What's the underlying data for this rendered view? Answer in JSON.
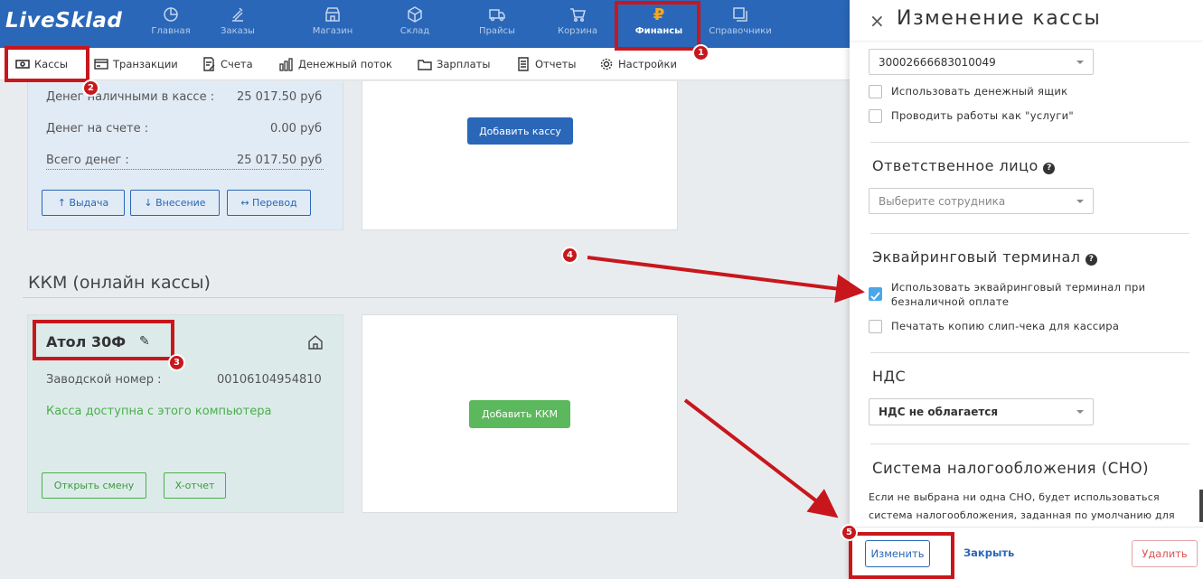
{
  "brand": "LiveSklad",
  "nav": [
    {
      "label": "Главная",
      "icon": "pie-chart-icon"
    },
    {
      "label": "Заказы",
      "icon": "clipboard-icon"
    },
    {
      "label": "Магазин",
      "icon": "store-icon"
    },
    {
      "label": "Склад",
      "icon": "box-icon"
    },
    {
      "label": "Прайсы",
      "icon": "truck-icon"
    },
    {
      "label": "Корзина",
      "icon": "cart-icon"
    },
    {
      "label": "Финансы",
      "icon": "ruble-icon",
      "glyph": "₽"
    },
    {
      "label": "Справочники",
      "icon": "books-icon"
    }
  ],
  "subnav": [
    {
      "label": "Кассы",
      "icon": "cash-icon"
    },
    {
      "label": "Транзакции",
      "icon": "card-icon"
    },
    {
      "label": "Счета",
      "icon": "invoice-icon"
    },
    {
      "label": "Денежный поток",
      "icon": "bars-icon"
    },
    {
      "label": "Зарплаты",
      "icon": "folder-icon"
    },
    {
      "label": "Отчеты",
      "icon": "report-icon"
    },
    {
      "label": "Настройки",
      "icon": "settings-icon"
    }
  ],
  "cash_card": {
    "rows": [
      {
        "label": "Денег наличными в кассе :",
        "value": "25 017.50 руб"
      },
      {
        "label": "Денег на счете :",
        "value": "0.00 руб"
      },
      {
        "label": "Всего денег :",
        "value": "25 017.50 руб"
      }
    ],
    "buttons": [
      "↑ Выдача",
      "↓ Внесение",
      "↔ Перевод"
    ]
  },
  "add_cash_button": "Добавить кассу",
  "kkm_section_title": "ККМ (онлайн кассы)",
  "kkm_card": {
    "name": "Атол 30Ф",
    "serial_label": "Заводской номер :",
    "serial_value": "00106104954810",
    "status": "Касса доступна с этого компьютера",
    "buttons": [
      "Открыть смену",
      "X-отчет"
    ]
  },
  "add_kkm_button": "Добавить ККМ",
  "panel": {
    "title": "Изменение кассы",
    "close": "×",
    "device_value": "30002666683010049",
    "checkboxes_top": [
      {
        "label": "Использовать денежный ящик",
        "checked": false
      },
      {
        "label": "Проводить работы как \"услуги\"",
        "checked": false
      }
    ],
    "responsible_title": "Ответственное лицо",
    "responsible_placeholder": "Выберите сотрудника",
    "acquiring_title": "Эквайринговый терминал",
    "acquiring_checkboxes": [
      {
        "line1": "Использовать эквайринговый терминал при",
        "line2": "безналичной оплате",
        "checked": true
      },
      {
        "line1": "Печатать копию слип-чека для кассира",
        "line2": "",
        "checked": false
      }
    ],
    "vat_title": "НДС",
    "vat_value": "НДС не облагается",
    "tax_title": "Система налогообложения (СНО)",
    "tax_note_1": "Если не выбрана ни одна СНО, будет использоваться",
    "tax_note_2": "система налогообложения, заданная по умолчанию для",
    "help_glyph": "?",
    "footer": {
      "save": "Изменить",
      "close": "Закрыть",
      "delete": "Удалить"
    }
  },
  "annotations": [
    "1",
    "2",
    "3",
    "4",
    "5"
  ],
  "colors": {
    "nav": "#2a67b8",
    "annotation": "#c8171c",
    "accent_orange": "#f5a623",
    "success": "#4cae4c",
    "primary_button": "#2a67b8",
    "kkm_button": "#5cb85c"
  }
}
